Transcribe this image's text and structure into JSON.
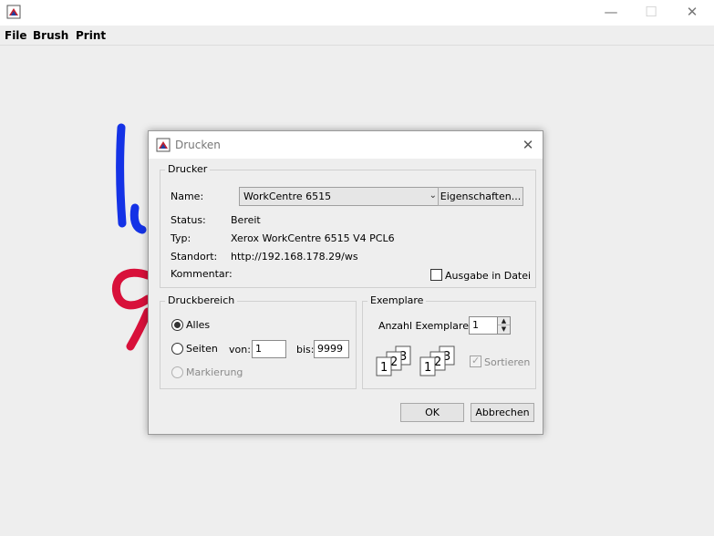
{
  "window": {
    "minimize": "—",
    "maximize": "☐",
    "close": "✕"
  },
  "menu": {
    "file": "File",
    "brush": "Brush",
    "print": "Print"
  },
  "dialog": {
    "title": "Drucken",
    "close": "✕",
    "printer": {
      "legend": "Drucker",
      "name_label": "Name:",
      "name_value": "WorkCentre 6515",
      "properties_button": "Eigenschaften...",
      "status_label": "Status:",
      "status_value": "Bereit",
      "type_label": "Typ:",
      "type_value": "Xerox WorkCentre 6515 V4 PCL6",
      "location_label": "Standort:",
      "location_value": "http://192.168.178.29/ws",
      "comment_label": "Kommentar:",
      "comment_value": "",
      "print_to_file_label": "Ausgabe in Datei",
      "print_to_file_checked": false
    },
    "range": {
      "legend": "Druckbereich",
      "all_label": "Alles",
      "pages_label": "Seiten",
      "from_label": "von:",
      "from_value": "1",
      "to_label": "bis:",
      "to_value": "9999",
      "selection_label": "Markierung",
      "selected": "all"
    },
    "copies": {
      "legend": "Exemplare",
      "count_label": "Anzahl Exemplare:",
      "count_value": "1",
      "collate_label": "Sortieren",
      "collate_checked": true,
      "collate_enabled": false,
      "page_numbers": [
        "1",
        "2",
        "3"
      ]
    },
    "ok_button": "OK",
    "cancel_button": "Abbrechen"
  },
  "colors": {
    "stroke_blue": "#1432e6",
    "stroke_red": "#d8103a"
  }
}
